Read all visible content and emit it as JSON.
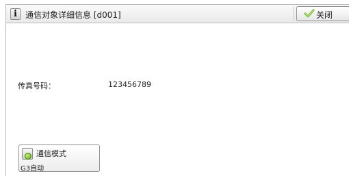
{
  "window": {
    "title": "通信对象详细信息 [d001]",
    "info_icon_char": "i",
    "close_label": "关闭"
  },
  "details": {
    "fax_label": "传真号码：",
    "fax_value": "123456789"
  },
  "mode_button": {
    "title": "通信模式",
    "value": "G3自动"
  },
  "colors": {
    "accent_green": "#6fb524",
    "check_green": "#7cc242"
  },
  "icons": {
    "title": "info-icon",
    "close": "check-icon",
    "mode": "green-dot-icon"
  }
}
